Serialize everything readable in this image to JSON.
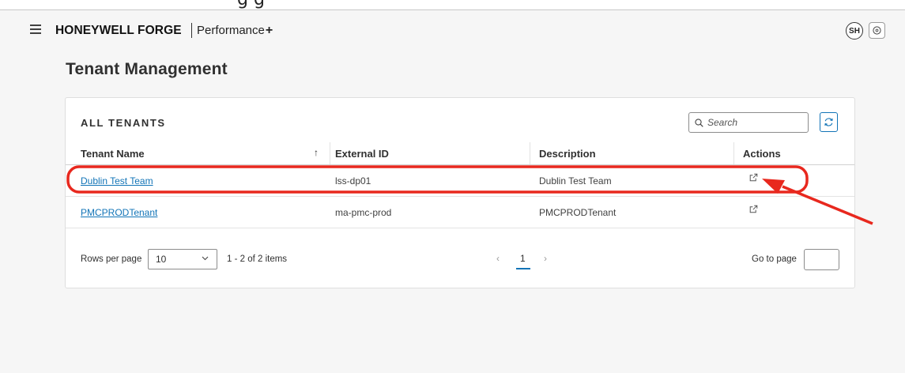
{
  "colors": {
    "accent": "#1274b7",
    "annotation": "#e8281e",
    "page_background": "#f6f6f6",
    "card_background": "#ffffff"
  },
  "top_cropped_text": "g   g",
  "header": {
    "menu_icon": "hamburger-icon",
    "brand": "HONEYWELL FORGE",
    "product": "Performance",
    "product_suffix": "+",
    "avatar_initials": "SH",
    "help_icon": "help-circle-icon"
  },
  "page": {
    "title": "Tenant Management"
  },
  "card": {
    "title": "ALL TENANTS",
    "search": {
      "placeholder": "Search",
      "value": "",
      "icon": "search-icon"
    },
    "refresh_icon": "refresh-icon"
  },
  "table": {
    "columns": [
      "Tenant Name",
      "External ID",
      "Description",
      "Actions"
    ],
    "sort": {
      "column": "Tenant Name",
      "direction": "ascending",
      "icon": "arrow-up-icon"
    },
    "rows": [
      {
        "tenant_name": "Dublin Test Team",
        "external_id": "lss-dp01",
        "description": "Dublin Test Team",
        "action_icon": "open-external-icon"
      },
      {
        "tenant_name": "PMCPRODTenant",
        "external_id": "ma-pmc-prod",
        "description": "PMCPRODTenant",
        "action_icon": "open-external-icon"
      }
    ]
  },
  "pagination": {
    "rows_per_page_label": "Rows per page",
    "rows_per_page_value": "10",
    "items_text": "1 - 2 of 2 items",
    "prev": "‹",
    "current_page": "1",
    "next": "›",
    "go_to_label": "Go to page",
    "go_to_value": ""
  }
}
